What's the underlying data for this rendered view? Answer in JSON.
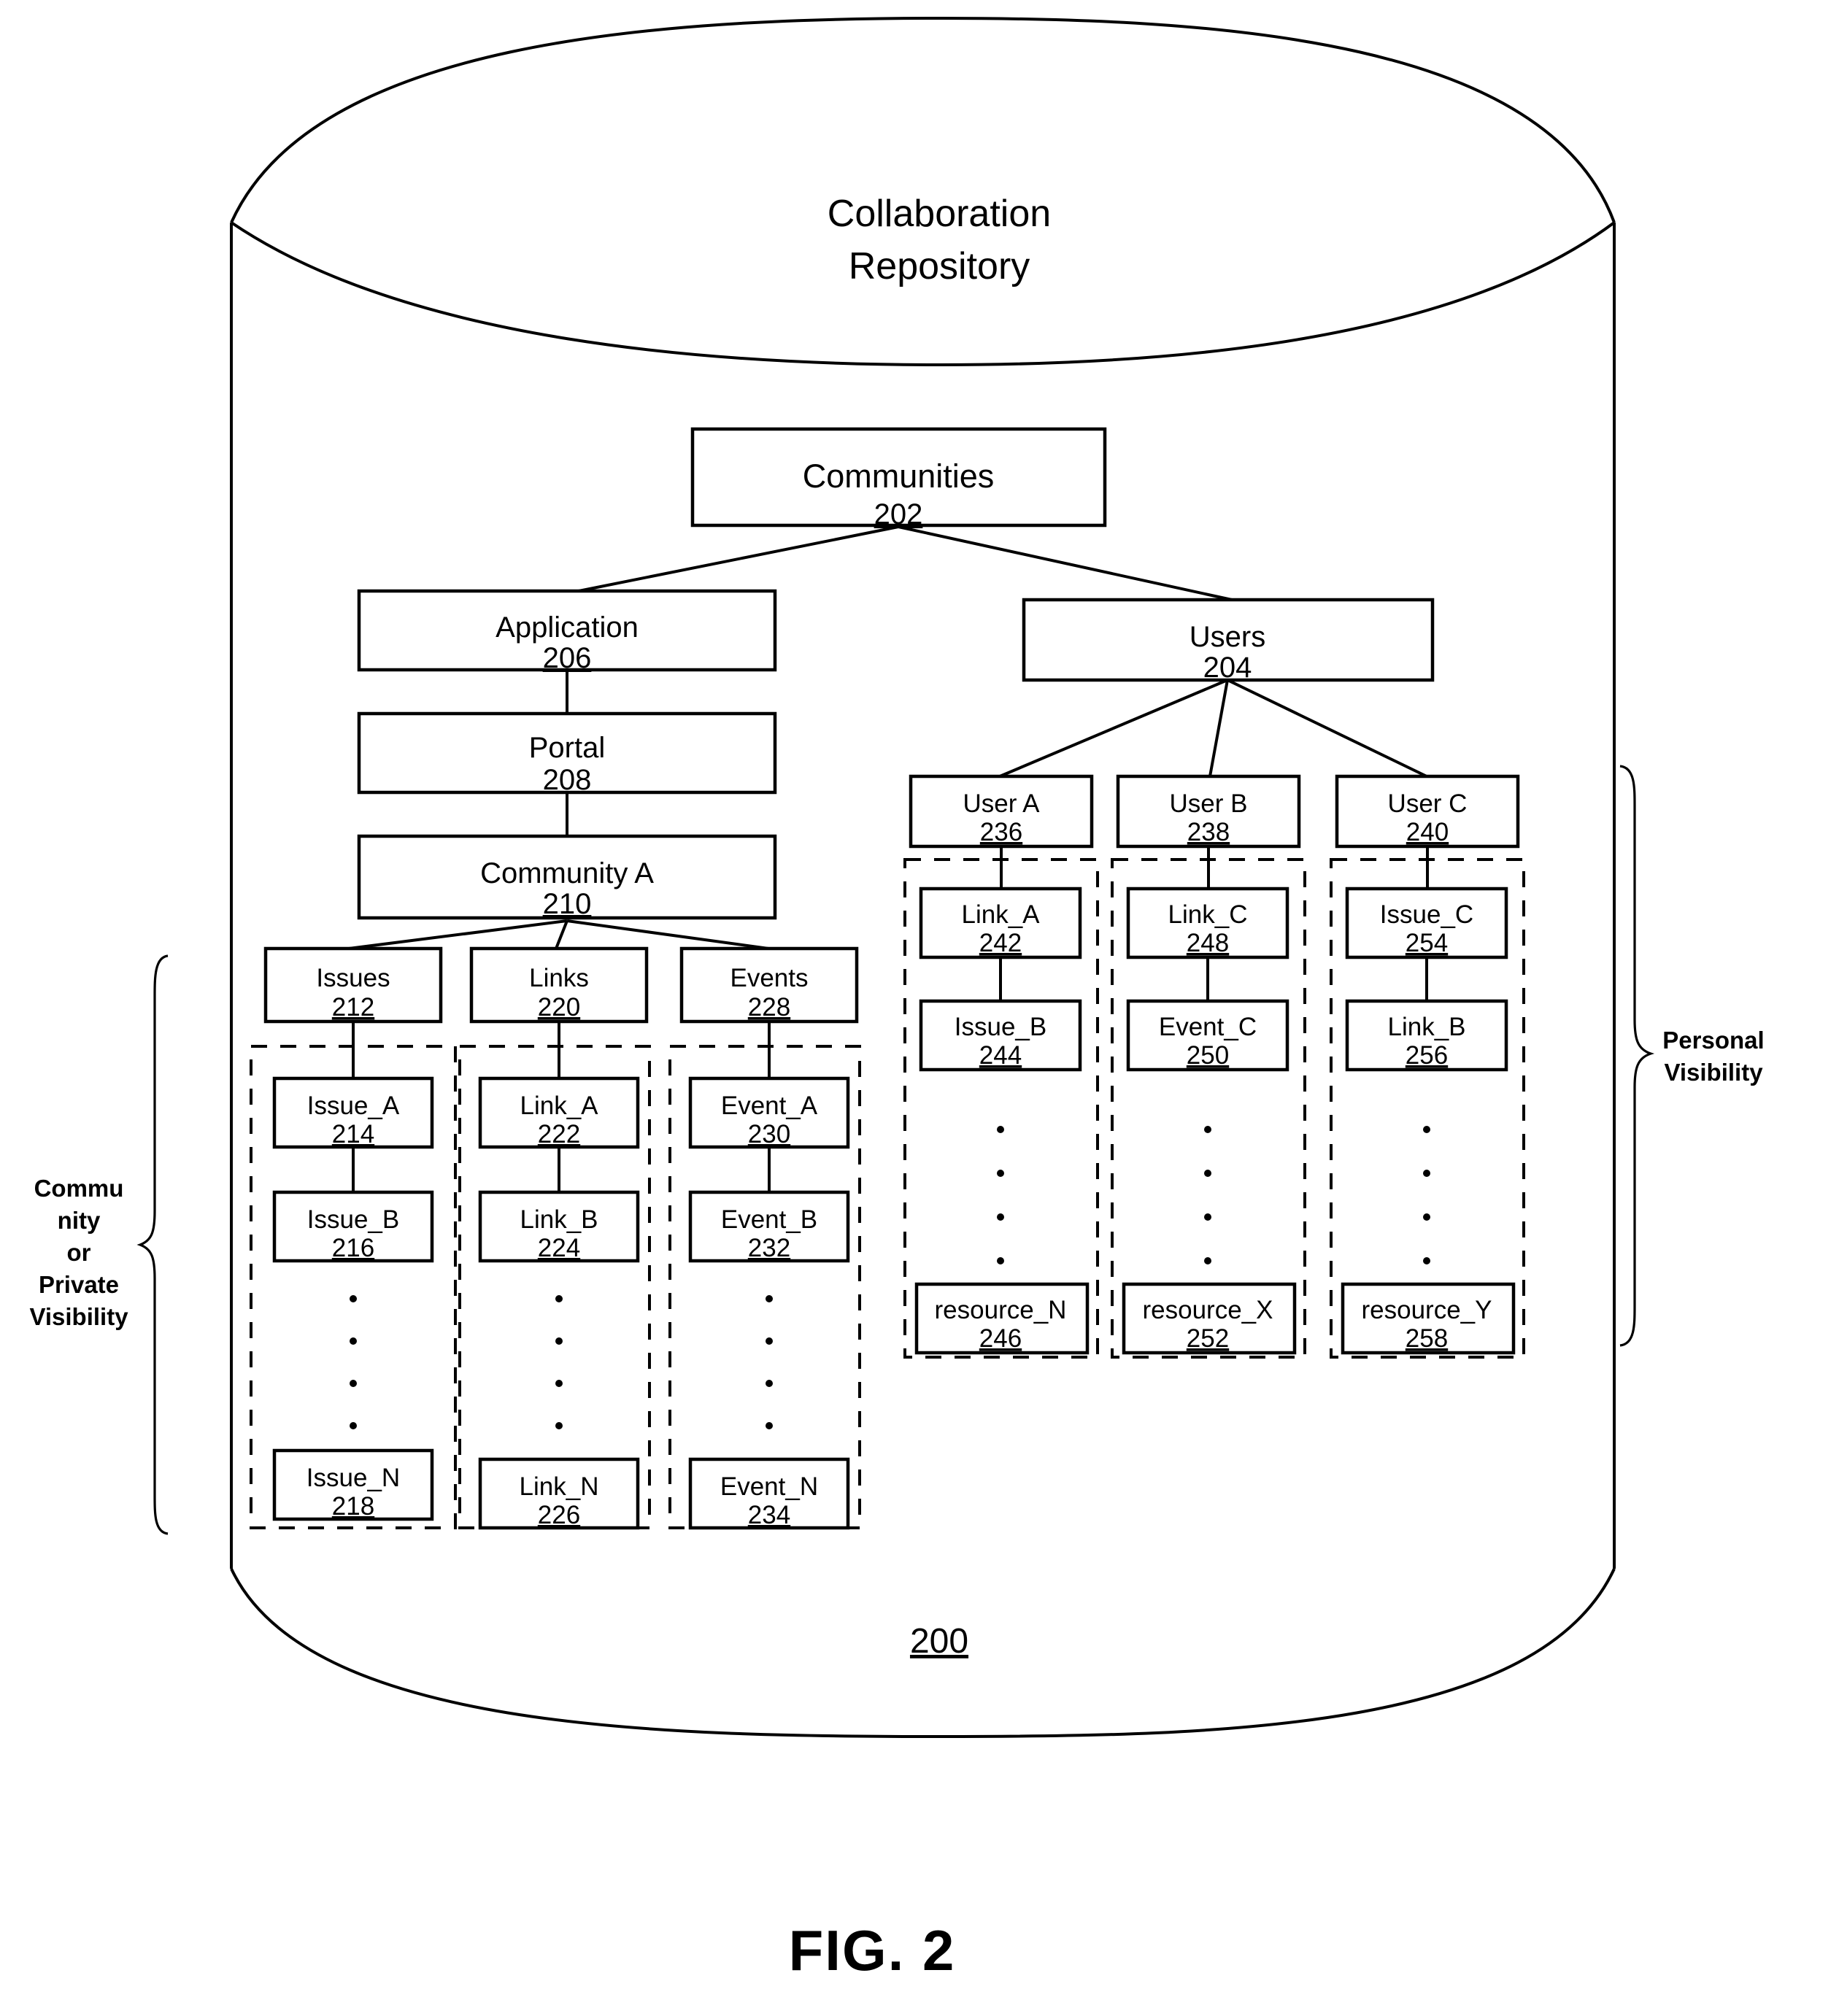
{
  "figure": {
    "caption": "FIG. 2",
    "reference_number": "200",
    "repository_title_line1": "Collaboration",
    "repository_title_line2": "Repository"
  },
  "root": {
    "label": "Communities",
    "ref": "202"
  },
  "application_branch": {
    "application": {
      "label": "Application",
      "ref": "206"
    },
    "portal": {
      "label": "Portal",
      "ref": "208"
    },
    "community": {
      "label": "Community A",
      "ref": "210"
    },
    "categories": [
      {
        "label": "Issues",
        "ref": "212",
        "items": [
          {
            "label": "Issue_A",
            "ref": "214"
          },
          {
            "label": "Issue_B",
            "ref": "216"
          },
          {
            "label": "Issue_N",
            "ref": "218"
          }
        ]
      },
      {
        "label": "Links",
        "ref": "220",
        "items": [
          {
            "label": "Link_A",
            "ref": "222"
          },
          {
            "label": "Link_B",
            "ref": "224"
          },
          {
            "label": "Link_N",
            "ref": "226"
          }
        ]
      },
      {
        "label": "Events",
        "ref": "228",
        "items": [
          {
            "label": "Event_A",
            "ref": "230"
          },
          {
            "label": "Event_B",
            "ref": "232"
          },
          {
            "label": "Event_N",
            "ref": "234"
          }
        ]
      }
    ]
  },
  "users_branch": {
    "users": {
      "label": "Users",
      "ref": "204"
    },
    "users_list": [
      {
        "label": "User A",
        "ref": "236",
        "resources": [
          {
            "label": "Link_A",
            "ref": "242"
          },
          {
            "label": "Issue_B",
            "ref": "244"
          },
          {
            "label": "resource_N",
            "ref": "246"
          }
        ]
      },
      {
        "label": "User B",
        "ref": "238",
        "resources": [
          {
            "label": "Link_C",
            "ref": "248"
          },
          {
            "label": "Event_C",
            "ref": "250"
          },
          {
            "label": "resource_X",
            "ref": "252"
          }
        ]
      },
      {
        "label": "User C",
        "ref": "240",
        "resources": [
          {
            "label": "Issue_C",
            "ref": "254"
          },
          {
            "label": "Link_B",
            "ref": "256"
          },
          {
            "label": "resource_Y",
            "ref": "258"
          }
        ]
      }
    ]
  },
  "annotations": {
    "left_bracket": {
      "lines": [
        "Commu",
        "nity",
        "or",
        "Private",
        "Visibility"
      ]
    },
    "right_bracket": {
      "lines": [
        "Personal",
        "Visibility"
      ]
    }
  },
  "colors": {
    "ink": "#000000",
    "paper": "#ffffff"
  }
}
